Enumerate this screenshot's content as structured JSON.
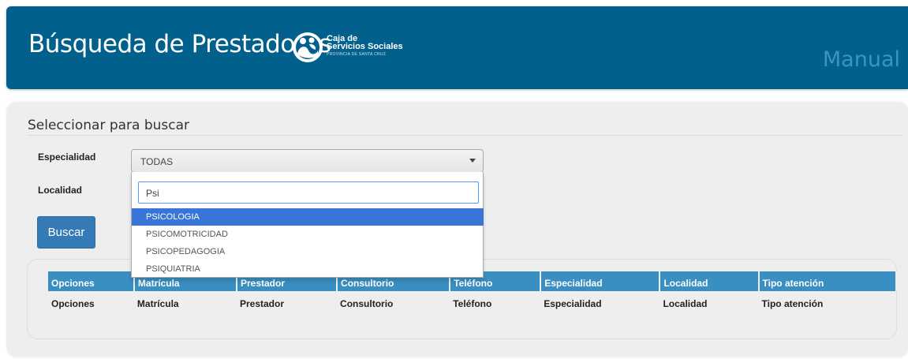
{
  "header": {
    "title": "Búsqueda de Prestadores",
    "logo": {
      "line1": "Caja de",
      "line2": "Servicios Sociales",
      "line3": "PROVINCIA DE SANTA CRUZ"
    },
    "manual_link": "Manual"
  },
  "form": {
    "section_title": "Seleccionar para buscar",
    "especialidad_label": "Especialidad",
    "localidad_label": "Localidad",
    "especialidad_selected": "TODAS",
    "search_value": "Psi",
    "options": [
      "PSICOLOGIA",
      "PSICOMOTRICIDAD",
      "PSICOPEDAGOGIA",
      "PSIQUIATRIA"
    ],
    "highlighted_option": "PSICOLOGIA",
    "submit_label": "Buscar"
  },
  "table": {
    "headers": [
      "Opciones",
      "Matrícula",
      "Prestador",
      "Consultorio",
      "Teléfono",
      "Especialidad",
      "Localidad",
      "Tipo atención"
    ],
    "footer": [
      "Opciones",
      "Matrícula",
      "Prestador",
      "Consultorio",
      "Teléfono",
      "Especialidad",
      "Localidad",
      "Tipo atención"
    ]
  },
  "colors": {
    "header_bg": "#01608c",
    "manual_link": "#3d95bf",
    "table_header_bg": "#3a8fc2",
    "button_bg": "#337ab7",
    "highlight": "#3875d7"
  }
}
